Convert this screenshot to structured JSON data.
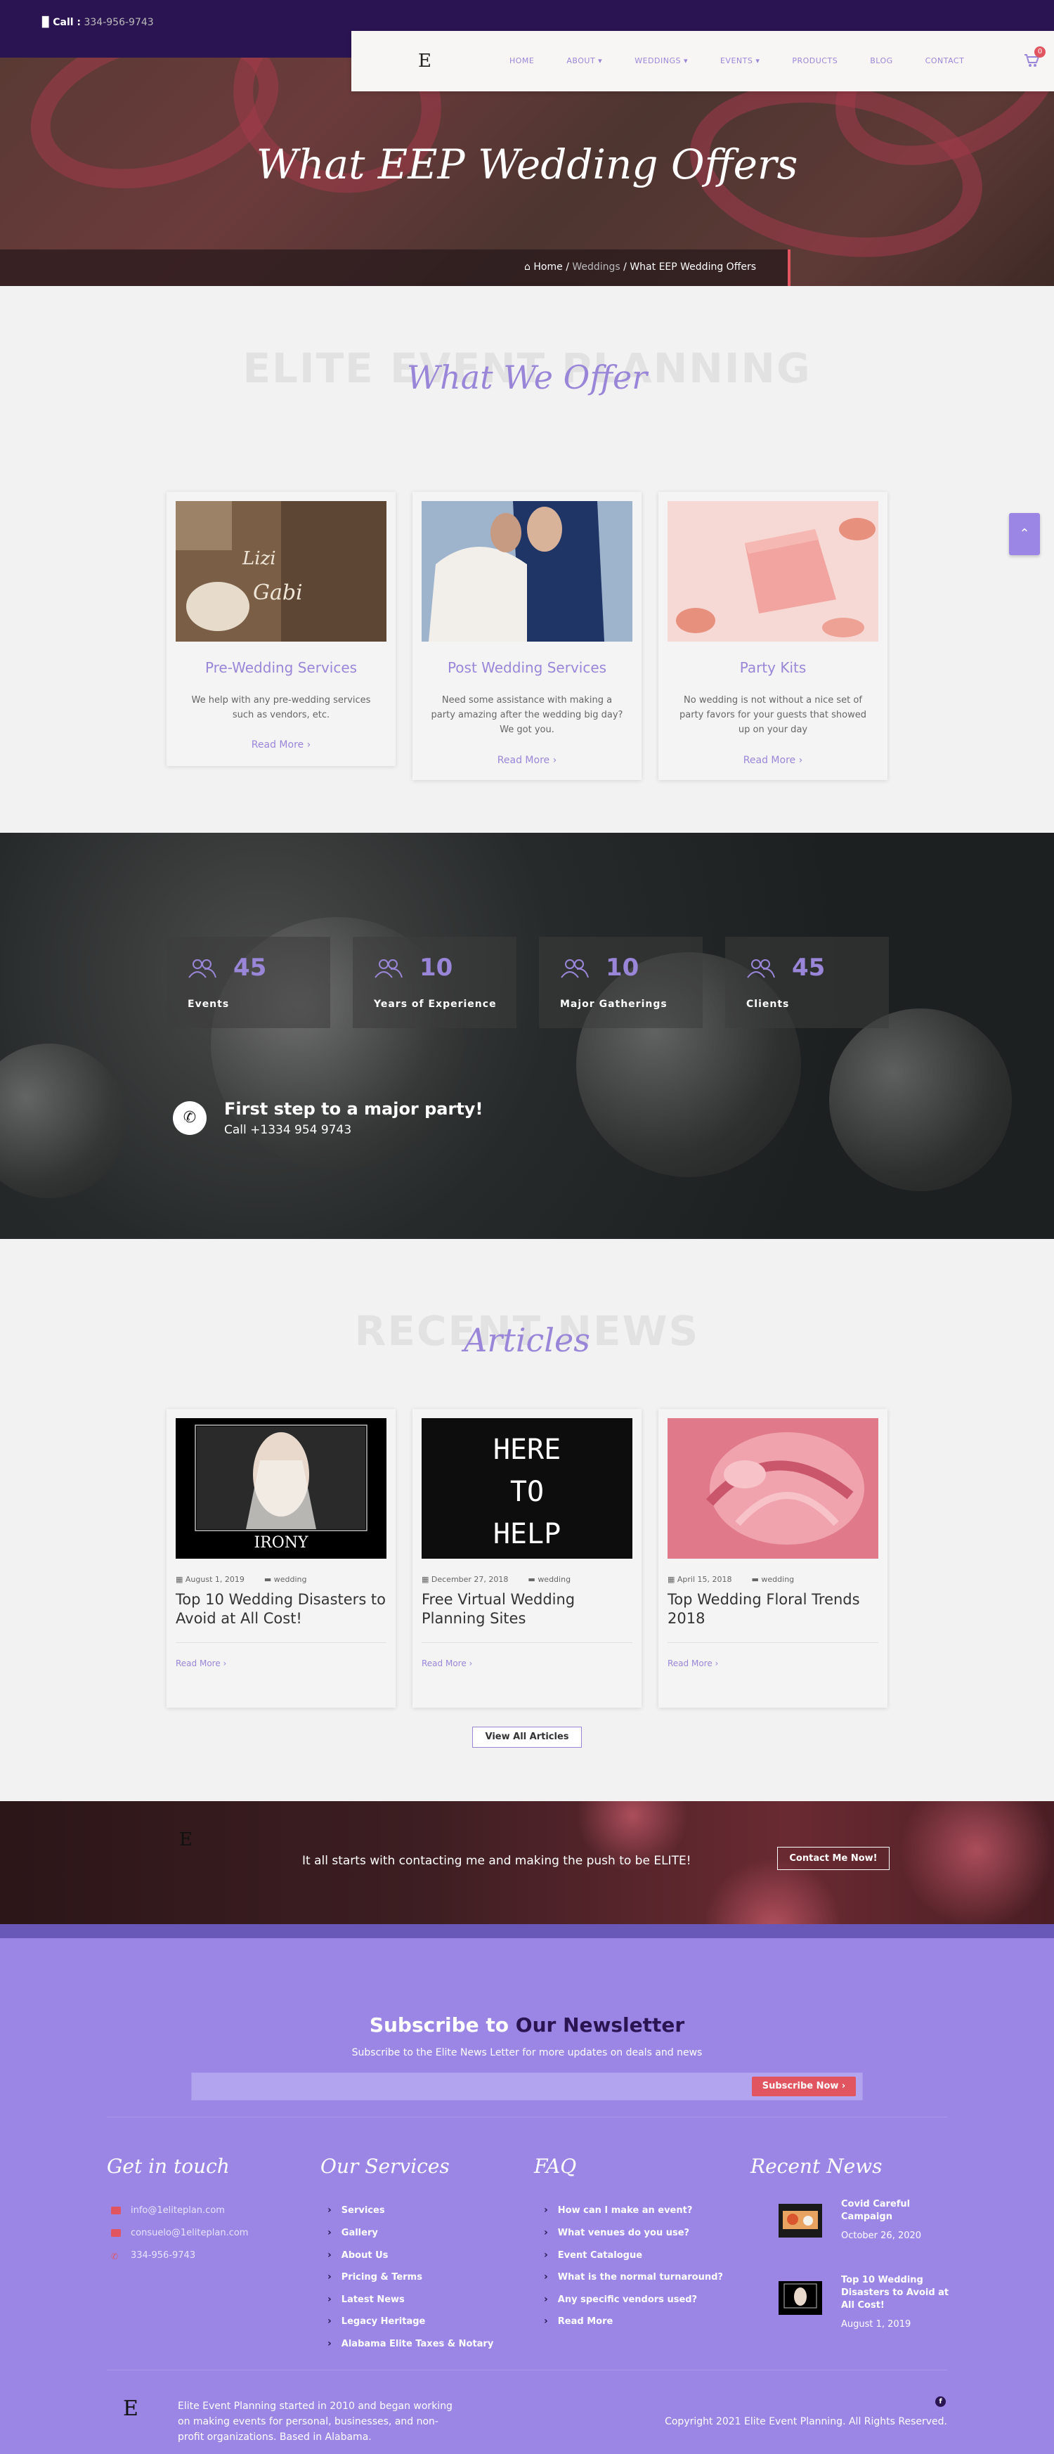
{
  "topbar": {
    "call_label": "Call :",
    "phone": "334-956-9743"
  },
  "nav": {
    "logo": "E",
    "items": [
      "HOME",
      "ABOUT ▾",
      "WEDDINGS ▾",
      "EVENTS ▾",
      "PRODUCTS",
      "BLOG",
      "CONTACT"
    ],
    "cart_count": "0"
  },
  "hero": {
    "title": "What EEP Wedding Offers"
  },
  "breadcrumb": {
    "home": "Home",
    "sep1": "/",
    "mid": "Weddings",
    "sep2": "/",
    "current": "What EEP Wedding Offers"
  },
  "offers": {
    "bg_title": "ELITE EVENT PLANNING",
    "title": "What We Offer",
    "cards": [
      {
        "title": "Pre-Wedding Services",
        "desc": "We help with any pre-wedding services such as vendors, etc.",
        "more": "Read More  ›"
      },
      {
        "title": "Post Wedding Services",
        "desc": "Need some assistance with making a party amazing after the wedding big day? We got you.",
        "more": "Read More  ›"
      },
      {
        "title": "Party Kits",
        "desc": "No wedding is not without a nice set of party favors for your guests that showed up on your day",
        "more": "Read More  ›"
      }
    ]
  },
  "stats": {
    "items": [
      {
        "value": "45",
        "label": "Events"
      },
      {
        "value": "10",
        "label": "Years of Experience"
      },
      {
        "value": "10",
        "label": "Major Gatherings"
      },
      {
        "value": "45",
        "label": "Clients"
      }
    ],
    "cta_title": "First step to a major party!",
    "cta_phone": "Call +1334 954 9743"
  },
  "news": {
    "bg_title": "RECENT NEWS",
    "title": "Articles",
    "articles": [
      {
        "date": "August 1, 2019",
        "category": "wedding",
        "title": "Top 10 Wedding Disasters to Avoid at All Cost!",
        "more": "Read More ›",
        "image_caption": "IRONY"
      },
      {
        "date": "December 27, 2018",
        "category": "wedding",
        "title": "Free Virtual Wedding Planning Sites",
        "more": "Read More ›",
        "image_caption": "HERE TO HELP"
      },
      {
        "date": "April 15, 2018",
        "category": "wedding",
        "title": "Top Wedding Floral Trends 2018",
        "more": "Read More ›",
        "image_caption": ""
      }
    ],
    "view_all": "View All Articles"
  },
  "cta": {
    "logo": "E",
    "text": "It all starts with contacting me and making the push to be ELITE!",
    "button": "Contact Me Now!"
  },
  "footer": {
    "subscribe_title_a": "Subscribe to",
    "subscribe_title_b": "Our Newsletter",
    "subscribe_desc": "Subscribe to the Elite News Letter for more updates on deals and news",
    "subscribe_button": "Subscribe Now  ›",
    "get_in_touch": {
      "title": "Get in touch",
      "items": [
        "info@1eliteplan.com",
        "consuelo@1eliteplan.com",
        "334-956-9743"
      ]
    },
    "services": {
      "title": "Our Services",
      "items": [
        "Services",
        "Gallery",
        "About Us",
        "Pricing & Terms",
        "Latest News",
        "Legacy Heritage",
        "Alabama Elite Taxes & Notary"
      ]
    },
    "faq": {
      "title": "FAQ",
      "items": [
        "How can I make an event?",
        "What venues do you use?",
        "Event Catalogue",
        "What is the normal turnaround?",
        "Any specific vendors used?",
        "Read More"
      ]
    },
    "recent_news": {
      "title": "Recent News",
      "items": [
        {
          "title": "Covid Careful Campaign",
          "date": "October 26, 2020"
        },
        {
          "title": "Top 10 Wedding Disasters to Avoid at All Cost!",
          "date": "August 1, 2019"
        }
      ]
    },
    "logo": "E",
    "about": "Elite Event Planning started in 2010 and began working on making events for personal, businesses, and non-profit organizations. Based in Alabama.",
    "copyright": "Copyright 2021 Elite Event Planning. All Rights Reserved.",
    "social_icon": "f"
  },
  "colors": {
    "accent": "#9a86d8",
    "dark_purple": "#2b1452",
    "footer_bg": "#9b86e6",
    "red": "#e05560"
  }
}
